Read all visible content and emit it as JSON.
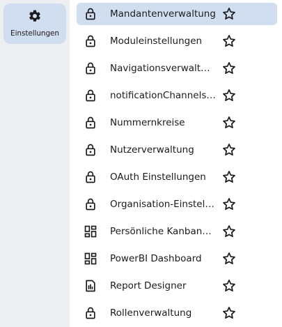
{
  "nav": {
    "active": {
      "label": "Einstellungen",
      "icon": "gear-icon"
    }
  },
  "list": {
    "selected_index": 0,
    "items": [
      {
        "label": "Mandantenverwaltung",
        "icon": "lock-icon"
      },
      {
        "label": "Moduleinstellungen",
        "icon": "lock-icon"
      },
      {
        "label": "Navigationsverwaltung",
        "icon": "lock-icon"
      },
      {
        "label": "notificationChannelsettings",
        "icon": "lock-icon"
      },
      {
        "label": "Nummernkreise",
        "icon": "lock-icon"
      },
      {
        "label": "Nutzerverwaltung",
        "icon": "lock-icon"
      },
      {
        "label": "OAuth Einstellungen",
        "icon": "lock-icon"
      },
      {
        "label": "Organisation-Einstellungen",
        "icon": "lock-icon"
      },
      {
        "label": "Persönliche Kanbanpanels",
        "icon": "dashboard-icon"
      },
      {
        "label": "PowerBI Dashboard",
        "icon": "dashboard-icon"
      },
      {
        "label": "Report Designer",
        "icon": "report-icon"
      },
      {
        "label": "Rollenverwaltung",
        "icon": "lock-icon"
      }
    ]
  },
  "colors": {
    "selected_bg": "#d1def0",
    "rail_bg": "#eeeff3",
    "icon": "#1b1b1f"
  }
}
